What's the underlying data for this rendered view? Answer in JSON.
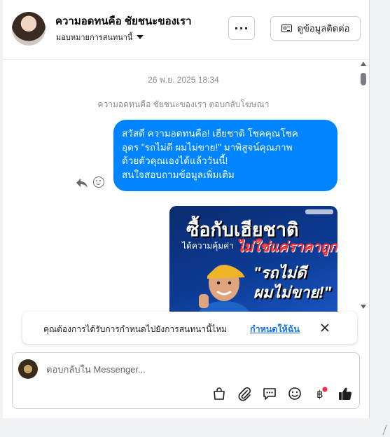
{
  "header": {
    "contact_name": "ความอดทนคือ ชัยชนะของเรา",
    "assign_label": "มอบหมายการสนทนานี้",
    "more_label": "···",
    "details_label": "ดูข้อมูลติดต่อ"
  },
  "thread": {
    "timestamp": "26 พ.ย. 2025 18:34",
    "system_note": "ความอดทนคือ ชัยชนะของเรา ตอบกลับโฆษณา",
    "message_text": "สวัสดี ความอดทนคือ! เฮียชาติ โชคคุณโชค\nอุดร \"รถไม่ดี ผมไม่ขาย!\" มาพิสูจน์คุณภาพ\nด้วยตัวคุณเองได้แล้ววันนี้!\nสนใจสอบถามข้อมูลเพิ่มเติม",
    "ad": {
      "headline": "ซื้อกับเฮียชาติ",
      "sub_white": "ได้ความคุ้มค่า",
      "sub_red": "ไม่ใช่แค่ราคาถูก!",
      "quote": "\"รถไม่ดี\nผมไม่ขาย!\""
    }
  },
  "notice": {
    "text": "คุณต้องการได้รับการกำหนดไปยังการสนทนานี้ไหม",
    "link": "กำหนดให้ฉัน"
  },
  "composer": {
    "placeholder": "ตอบกลับใน Messenger..."
  },
  "icons": {
    "bag": "shopping-bag-icon",
    "attach": "paperclip-icon",
    "saved_replies": "chat-bubble-icon",
    "emoji": "emoji-icon",
    "payment": "baht-icon",
    "like": "thumbs-up-icon"
  },
  "colors": {
    "bubble": "#0084ff",
    "link": "#1b74e4",
    "badge": "#f02849"
  }
}
